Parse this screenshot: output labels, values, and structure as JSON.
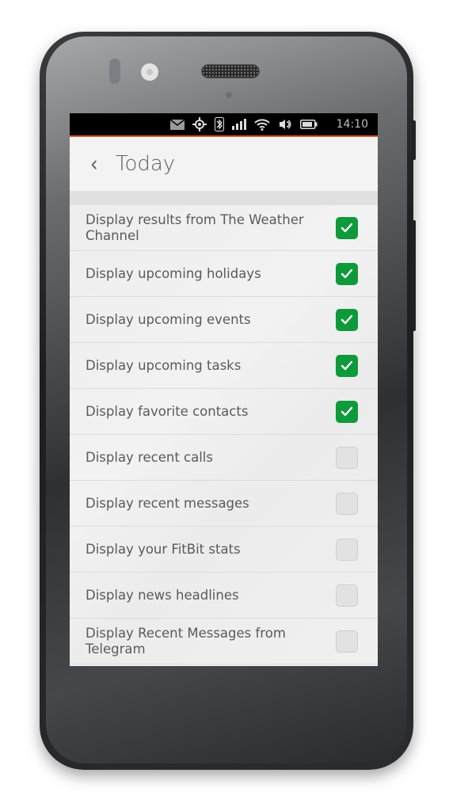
{
  "status_bar": {
    "icons": [
      "envelope-icon",
      "location-icon",
      "bluetooth-icon",
      "signal-icon",
      "wifi-icon",
      "volume-icon",
      "battery-icon"
    ],
    "time": "14:10"
  },
  "header": {
    "back_glyph": "‹",
    "title": "Today"
  },
  "colors": {
    "accent": "#e95420",
    "checked": "#0e9a3a"
  },
  "settings": [
    {
      "label": "Display results from The Weather Channel",
      "checked": true
    },
    {
      "label": "Display upcoming holidays",
      "checked": true
    },
    {
      "label": "Display upcoming events",
      "checked": true
    },
    {
      "label": "Display upcoming tasks",
      "checked": true
    },
    {
      "label": "Display favorite contacts",
      "checked": true
    },
    {
      "label": "Display recent calls",
      "checked": false
    },
    {
      "label": "Display recent messages",
      "checked": false
    },
    {
      "label": "Display your FitBit stats",
      "checked": false
    },
    {
      "label": "Display news headlines",
      "checked": false
    },
    {
      "label": "Display Recent Messages from Telegram",
      "checked": false
    }
  ]
}
